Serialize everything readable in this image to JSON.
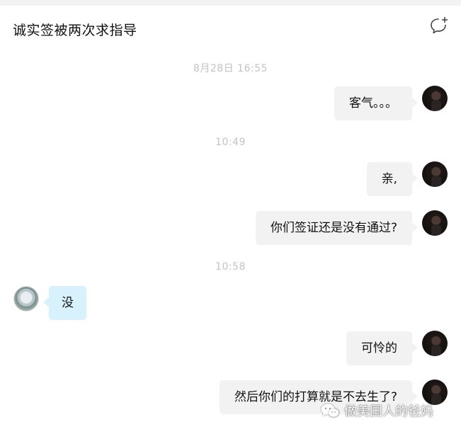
{
  "header": {
    "title": "诚实签被两次求指导",
    "icon": "new-chat-icon"
  },
  "timestamps": [
    "8月28日  16:55",
    "10:49",
    "10:58"
  ],
  "messages": [
    {
      "sender": "me",
      "text": "客气。。。"
    },
    {
      "sender": "me",
      "text": "亲,"
    },
    {
      "sender": "me",
      "text": "你们签证还是没有通过?"
    },
    {
      "sender": "other",
      "text": "没"
    },
    {
      "sender": "me",
      "text": "可怜的"
    },
    {
      "sender": "me",
      "text": "然后你们的打算就是不去生了?"
    }
  ],
  "watermark": {
    "icon": "wechat-icon",
    "text": "做美国人的爸妈"
  },
  "colors": {
    "my_bubble": "#f2f2f2",
    "other_bubble": "#d7f1fd",
    "timestamp": "#c3c3c3"
  }
}
